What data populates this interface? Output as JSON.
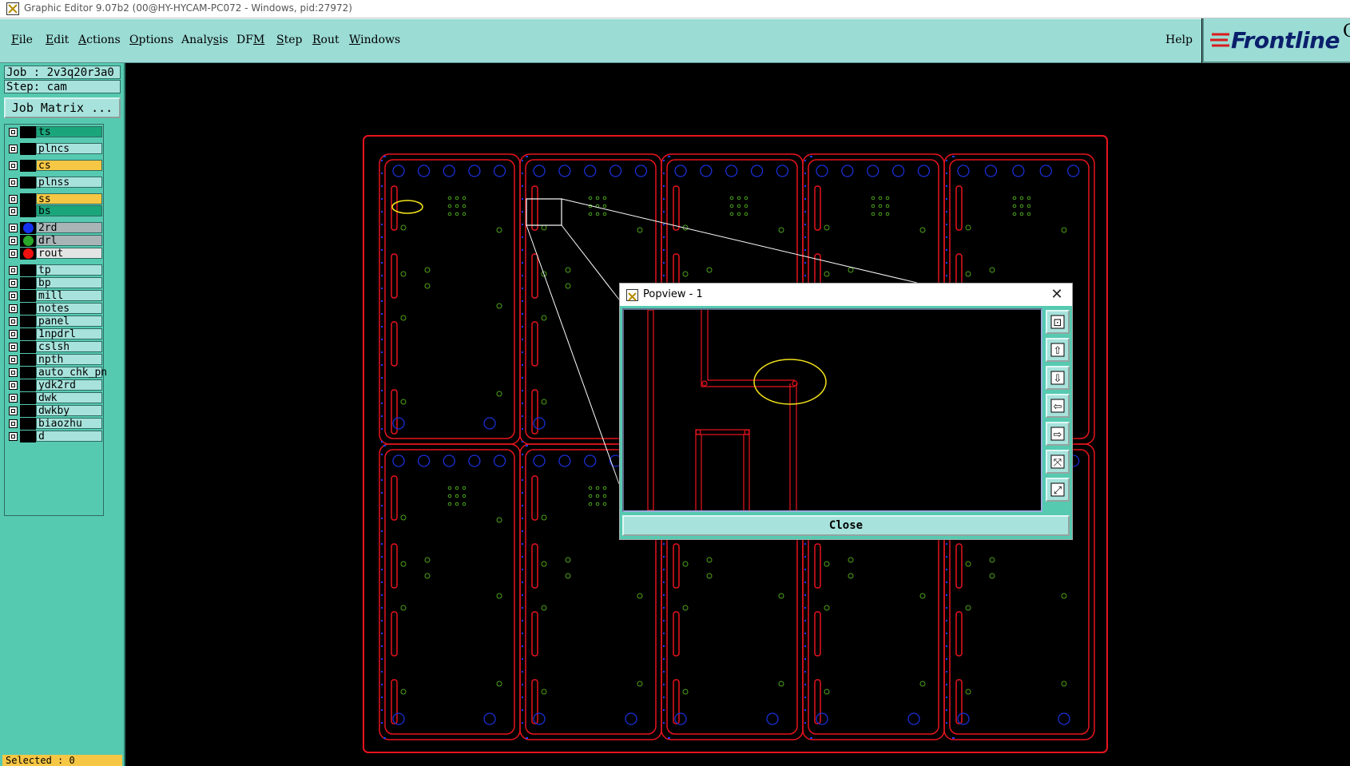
{
  "window": {
    "title": "Graphic Editor 9.07b2 (00@HY-HYCAM-PC072 - Windows, pid:27972)"
  },
  "menu": {
    "items": [
      {
        "pre": "",
        "u": "F",
        "post": "ile"
      },
      {
        "pre": "",
        "u": "E",
        "post": "dit"
      },
      {
        "pre": "",
        "u": "A",
        "post": "ctions"
      },
      {
        "pre": "",
        "u": "O",
        "post": "ptions"
      },
      {
        "pre": "Analy",
        "u": "s",
        "post": "is"
      },
      {
        "pre": "DF",
        "u": "M",
        "post": ""
      },
      {
        "pre": "",
        "u": "S",
        "post": "tep"
      },
      {
        "pre": "",
        "u": "R",
        "post": "out"
      },
      {
        "pre": "",
        "u": "W",
        "post": "indows"
      }
    ],
    "help": "Help"
  },
  "logo": {
    "text": "Frontline",
    "trailing": "G"
  },
  "panel": {
    "job": "Job : 2v3q20r3a0",
    "step": "Step: cam",
    "job_matrix": "Job Matrix ..."
  },
  "layers": [
    {
      "name": "ts",
      "color": "#1aa67a",
      "dot": ""
    },
    {
      "name": "plncs",
      "color": "#a7e3dc",
      "dot": ""
    },
    {
      "name": "cs",
      "color": "#f6c744",
      "dot": ""
    },
    {
      "name": "plnss",
      "color": "#a7e3dc",
      "dot": ""
    },
    {
      "name": "ss",
      "color": "#f6c744",
      "dot": ""
    },
    {
      "name": "bs",
      "color": "#1aa67a",
      "dot": ""
    },
    {
      "name": "2rd",
      "color": "#a9b4b7",
      "dot": "#1531f0"
    },
    {
      "name": "drl",
      "color": "#a9b4b7",
      "dot": "#2aa82a"
    },
    {
      "name": "rout",
      "color": "#e4e4e4",
      "dot": "#f01010"
    },
    {
      "name": "tp",
      "color": "#a7e3dc",
      "dot": ""
    },
    {
      "name": "bp",
      "color": "#a7e3dc",
      "dot": ""
    },
    {
      "name": "mill",
      "color": "#a7e3dc",
      "dot": ""
    },
    {
      "name": "notes",
      "color": "#a7e3dc",
      "dot": ""
    },
    {
      "name": "panel",
      "color": "#a7e3dc",
      "dot": ""
    },
    {
      "name": "1npdrl",
      "color": "#a7e3dc",
      "dot": ""
    },
    {
      "name": "cslsh",
      "color": "#a7e3dc",
      "dot": ""
    },
    {
      "name": "npth",
      "color": "#a7e3dc",
      "dot": ""
    },
    {
      "name": "auto_chk_pn",
      "color": "#a7e3dc",
      "dot": ""
    },
    {
      "name": "ydk2rd",
      "color": "#a7e3dc",
      "dot": ""
    },
    {
      "name": "dwk",
      "color": "#a7e3dc",
      "dot": ""
    },
    {
      "name": "dwkby",
      "color": "#a7e3dc",
      "dot": ""
    },
    {
      "name": "biaozhu",
      "color": "#a7e3dc",
      "dot": ""
    },
    {
      "name": "d",
      "color": "#a7e3dc",
      "dot": ""
    }
  ],
  "status": {
    "selected": "Selected : 0"
  },
  "popview": {
    "title": "Popview - 1",
    "close_label": "Close",
    "close_glyph": "✕",
    "tools": [
      "zoom-home-icon",
      "pan-up-icon",
      "pan-down-icon",
      "pan-left-icon",
      "pan-right-icon",
      "zoom-in-icon",
      "zoom-out-icon"
    ]
  },
  "colors": {
    "rout": "#e8141e",
    "blue_dashes": "#1d3bff",
    "blue_pads": "#1a2fd6",
    "green_holes": "#4ca21b",
    "highlight": "#f2e21a"
  }
}
